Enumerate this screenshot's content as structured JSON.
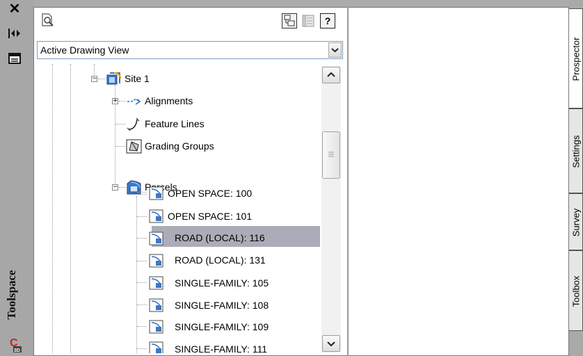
{
  "palette": {
    "title_strip": "#a7a7a7",
    "selection": "#acacb9",
    "accent_blue": "#3a78c8",
    "logo_red": "#d11f1f"
  },
  "titlebar": {
    "close_icon": "close-icon",
    "autohide_icon": "auto-hide-icon",
    "properties_icon": "properties-icon",
    "label": "Toolspace",
    "logo_text": "3D"
  },
  "toolbar": {
    "help_label": "?"
  },
  "view_select": {
    "value": "Active Drawing View"
  },
  "tree": {
    "site": "Site 1",
    "alignments": "Alignments",
    "feature_lines": "Feature Lines",
    "grading_groups": "Grading Groups",
    "parcels": "Parcels",
    "parcel_items": [
      "OPEN SPACE: 100",
      "OPEN SPACE: 101",
      "ROAD (LOCAL): 116",
      "ROAD (LOCAL): 131",
      "SINGLE-FAMILY: 105",
      "SINGLE-FAMILY: 108",
      "SINGLE-FAMILY: 109",
      "SINGLE-FAMILY: 111"
    ],
    "selected_item": "ROAD (LOCAL): 116"
  },
  "tabs": [
    "Prospector",
    "Settings",
    "Survey",
    "Toolbox"
  ]
}
